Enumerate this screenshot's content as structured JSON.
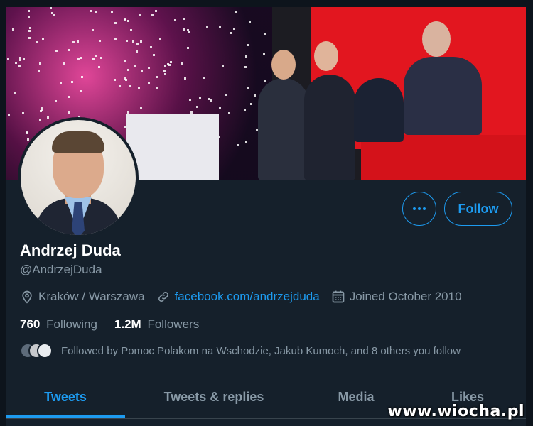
{
  "profile": {
    "display_name": "Andrzej Duda",
    "handle": "@AndrzejDuda",
    "location": "Kraków / Warszawa",
    "website": "facebook.com/andrzejduda",
    "joined": "Joined October 2010"
  },
  "actions": {
    "more_icon": "more-horizontal-icon",
    "follow_label": "Follow"
  },
  "stats": {
    "following_count": "760",
    "following_label": "Following",
    "followers_count": "1.2M",
    "followers_label": "Followers"
  },
  "followed_by": {
    "text": "Followed by Pomoc Polakom na Wschodzie, Jakub Kumoch, and 8 others you follow"
  },
  "tabs": [
    {
      "label": "Tweets",
      "active": true
    },
    {
      "label": "Tweets & replies",
      "active": false
    },
    {
      "label": "Media",
      "active": false
    },
    {
      "label": "Likes",
      "active": false
    }
  ],
  "icons": {
    "location": "location-pin-icon",
    "link": "link-icon",
    "calendar": "calendar-icon"
  },
  "colors": {
    "background": "#15202b",
    "accent": "#1d9bf0",
    "secondary_text": "#8899a6"
  },
  "watermark": "www.wiocha.pl"
}
